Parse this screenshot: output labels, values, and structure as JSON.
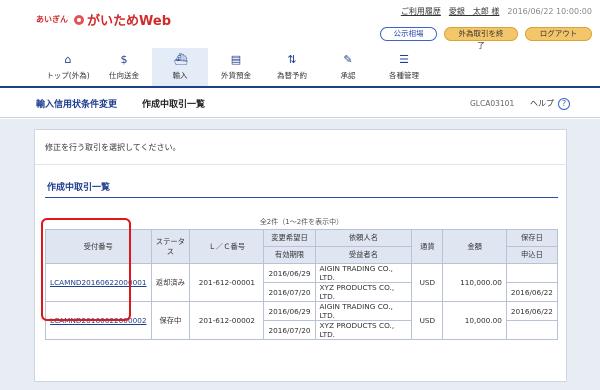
{
  "header": {
    "logo_small": "あいぎん",
    "logo_main": "がいためWeb",
    "links": {
      "history": "ご利用履歴",
      "user": "愛銀　太郎 様",
      "datetime": "2016/06/22 10:00:00"
    },
    "buttons": {
      "rates": "公示相場",
      "end": "外為取引を終了",
      "logout": "ログアウト"
    }
  },
  "nav": {
    "items": [
      {
        "label": "トップ(外為)",
        "icon": "home-icon"
      },
      {
        "label": "仕向送金",
        "icon": "remit-icon"
      },
      {
        "label": "輸入",
        "icon": "ship-icon"
      },
      {
        "label": "外貨預金",
        "icon": "deposit-icon"
      },
      {
        "label": "為替予約",
        "icon": "forward-icon"
      },
      {
        "label": "承認",
        "icon": "approve-icon"
      },
      {
        "label": "各種管理",
        "icon": "manage-icon"
      }
    ]
  },
  "titlebar": {
    "section": "輸入信用状条件変更",
    "page": "作成中取引一覧",
    "code": "GLCA03101",
    "help": "ヘルプ"
  },
  "main": {
    "instruction": "修正を行う取引を選択してください。",
    "section_title": "作成中取引一覧",
    "count_text": "全2件（1～2件を表示中）",
    "table": {
      "headers": {
        "receipt": "受付番号",
        "status": "ステータス",
        "lc": "Ｌ／Ｃ番号",
        "change_date": "変更希望日",
        "expiry": "有効期限",
        "applicant": "依頼人名",
        "beneficiary": "受益者名",
        "currency": "通貨",
        "amount": "金額",
        "saved": "保存日",
        "applied": "申込日"
      },
      "rows": [
        {
          "receipt": "LCAMND20160622000001",
          "status": "返却済み",
          "lc": "201-612-00001",
          "change_date": "2016/06/29",
          "expiry": "2016/07/20",
          "applicant": "AIGIN TRADING CO., LTD.",
          "beneficiary": "XYZ PRODUCTS CO., LTD.",
          "currency": "USD",
          "amount": "110,000.00",
          "saved": "",
          "applied": "2016/06/22"
        },
        {
          "receipt": "LCAMND20160622000002",
          "status": "保存中",
          "lc": "201-612-00002",
          "change_date": "2016/06/29",
          "expiry": "2016/07/20",
          "applicant": "AIGIN TRADING CO., LTD.",
          "beneficiary": "XYZ PRODUCTS CO., LTD.",
          "currency": "USD",
          "amount": "10,000.00",
          "saved": "2016/06/22",
          "applied": ""
        }
      ]
    }
  },
  "colors": {
    "primary": "#1f3f8f",
    "accent_orange": "#f4c66a",
    "highlight_red": "#e0161b"
  }
}
